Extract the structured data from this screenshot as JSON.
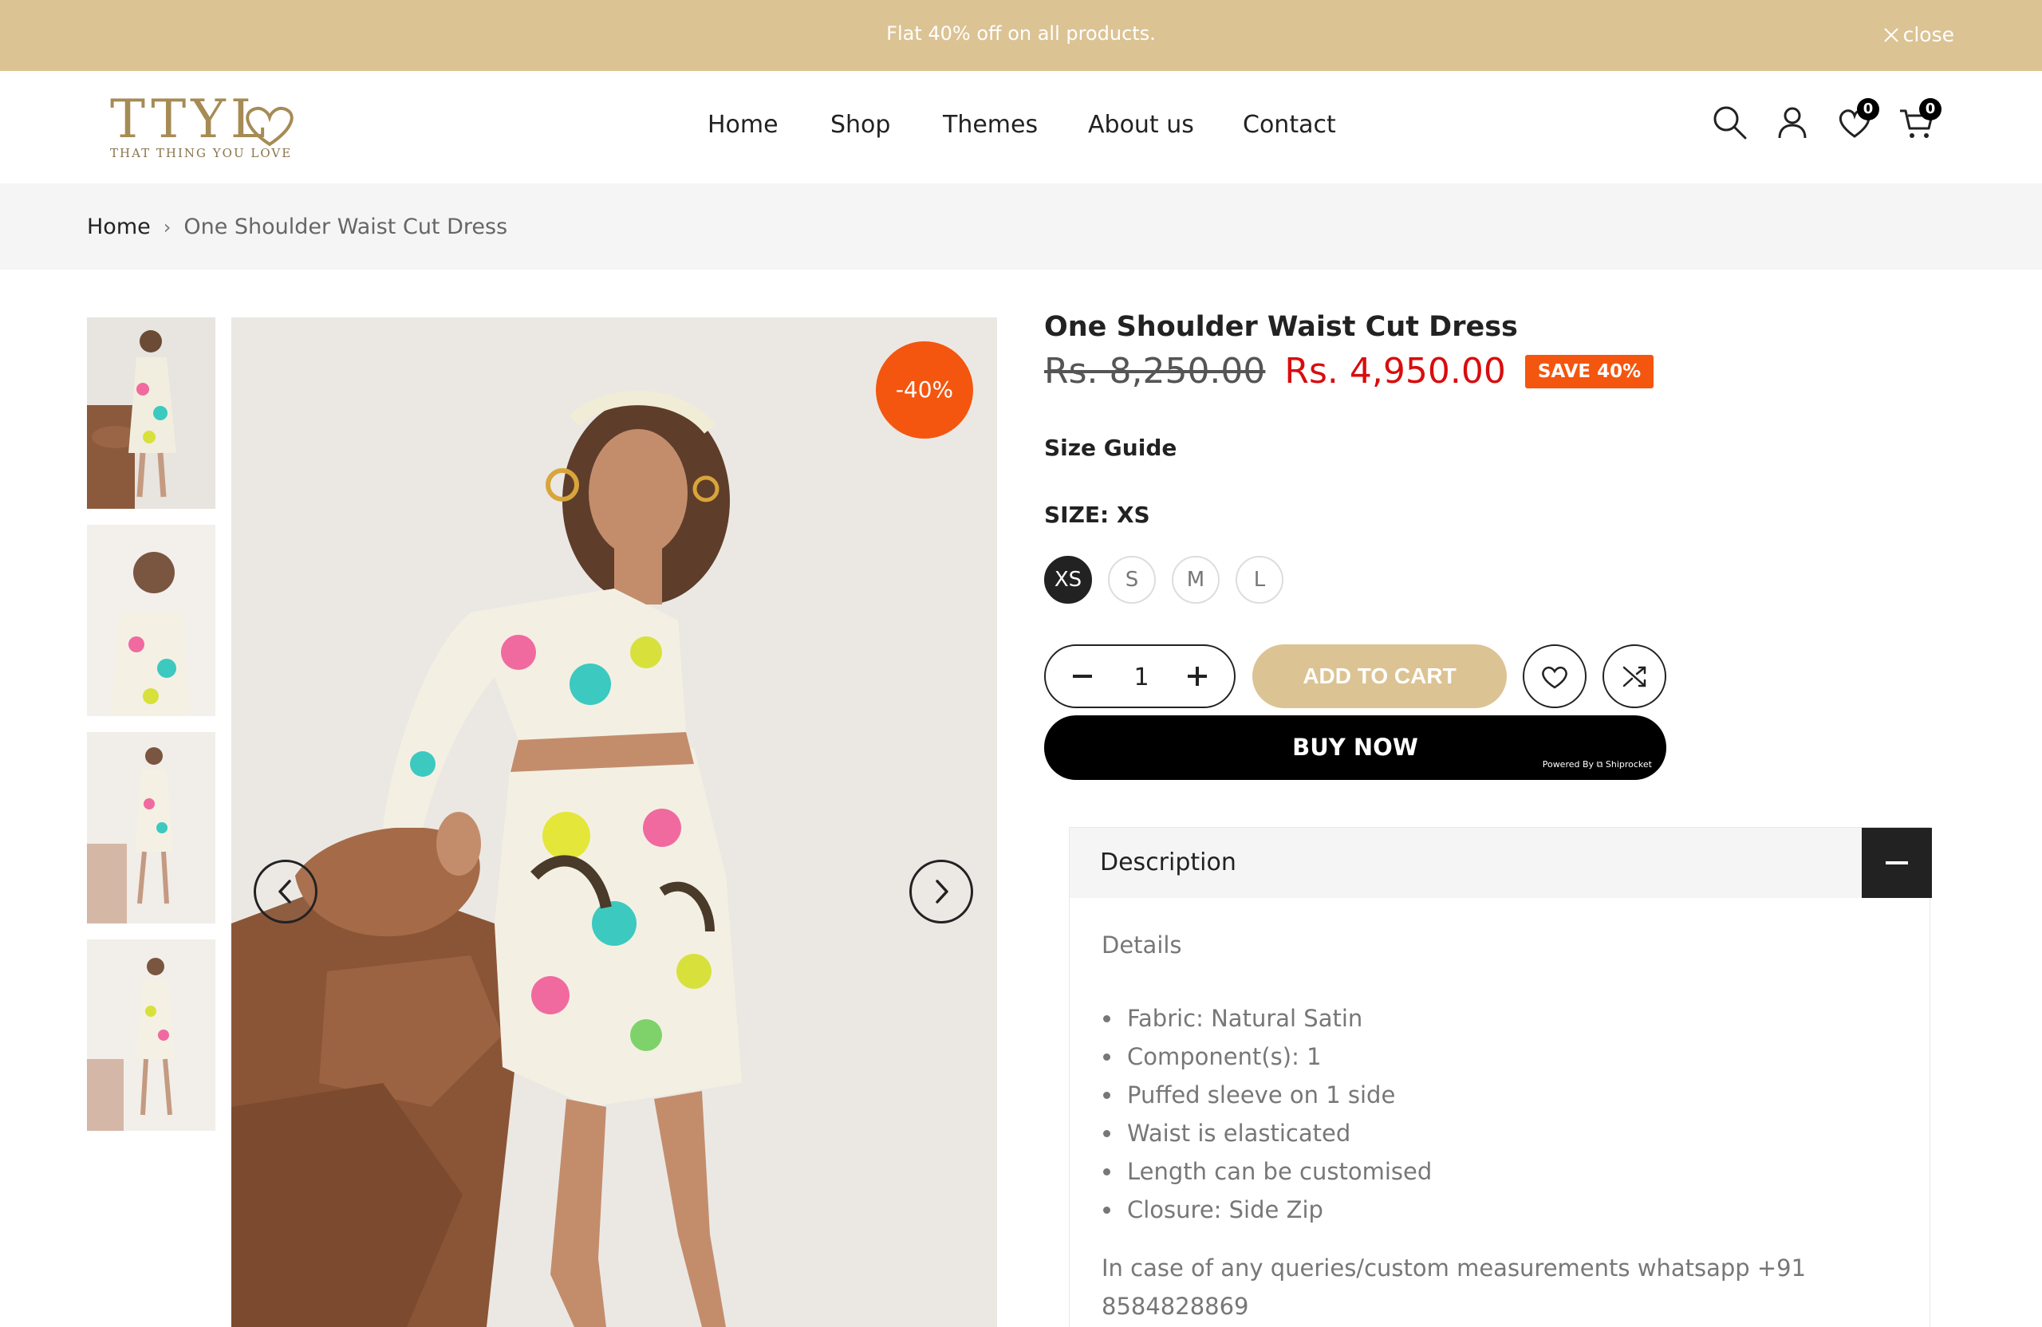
{
  "announcement": {
    "text": "Flat 40% off on all products.",
    "close_label": "close"
  },
  "header": {
    "logo_text": "TTYL",
    "logo_tagline": "THAT THING YOU LOVE",
    "nav": [
      "Home",
      "Shop",
      "Themes",
      "About us",
      "Contact"
    ],
    "wishlist_count": "0",
    "cart_count": "0",
    "icons": [
      "search-icon",
      "account-icon",
      "wishlist-heart-icon",
      "cart-icon"
    ]
  },
  "breadcrumb": {
    "home": "Home",
    "separator": "›",
    "current": "One Shoulder Waist Cut Dress"
  },
  "gallery": {
    "discount_badge": "-40%",
    "thumbnail_count": 4
  },
  "product": {
    "title": "One Shoulder Waist Cut Dress",
    "original_price": "Rs. 8,250.00",
    "sale_price": "Rs. 4,950.00",
    "save_badge": "SAVE 40%",
    "size_guide": "Size Guide",
    "size_label": "SIZE: XS",
    "sizes": [
      "XS",
      "S",
      "M",
      "L"
    ],
    "selected_size": "XS",
    "quantity": "1",
    "add_to_cart": "ADD TO CART",
    "buy_now": "BUY NOW",
    "powered_by": "Powered By ⧉ Shiprocket"
  },
  "description": {
    "heading": "Description",
    "subheading": "Details",
    "items": [
      "Fabric: Natural Satin",
      "Component(s): 1",
      "Puffed sleeve on 1 side",
      "Waist is elasticated",
      "Length can be customised",
      "Closure: Side Zip"
    ],
    "note": "In case of any queries/custom measurements whatsapp +91 8584828869"
  },
  "colors": {
    "accent_gold": "#dcc394",
    "sale_red": "#d90d0d",
    "badge_orange": "#f4560f"
  }
}
